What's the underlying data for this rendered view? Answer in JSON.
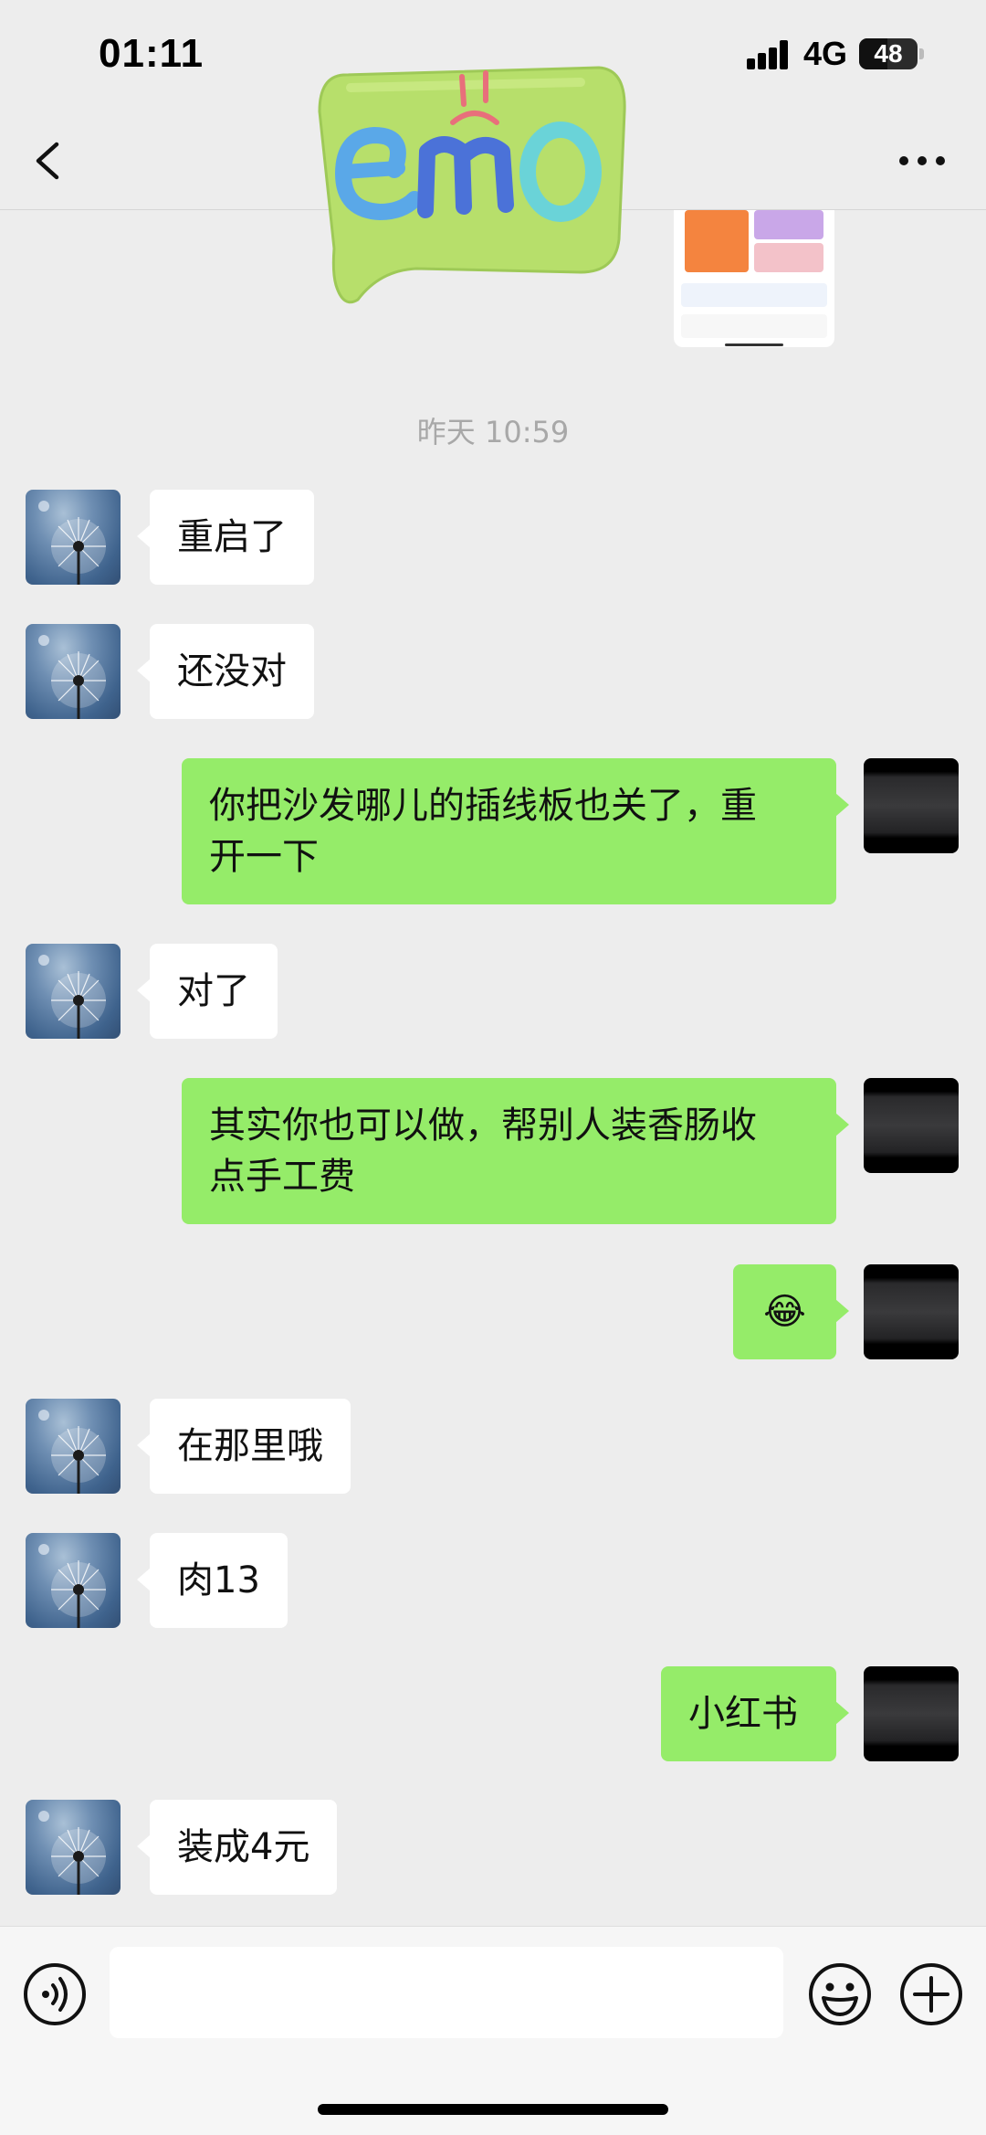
{
  "status_bar": {
    "time": "01:11",
    "network": "4G",
    "battery": "48",
    "battery_level": 0.48
  },
  "nav": {
    "back_icon": "chevron-left-icon",
    "more_icon": "more-dots-icon"
  },
  "sticker": {
    "text": "emo"
  },
  "timestamp": "昨天 10:59",
  "messages": [
    {
      "side": "in",
      "text": "重启了"
    },
    {
      "side": "in",
      "text": "还没对"
    },
    {
      "side": "out",
      "text": "你把沙发哪儿的插线板也关了，重\n开一下"
    },
    {
      "side": "in",
      "text": "对了"
    },
    {
      "side": "out",
      "text": "其实你也可以做，帮别人装香肠收\n点手工费"
    },
    {
      "side": "out",
      "text": "😂"
    },
    {
      "side": "in",
      "text": "在那里哦"
    },
    {
      "side": "in",
      "text": "肉13"
    },
    {
      "side": "out",
      "text": "小红书"
    },
    {
      "side": "in",
      "text": "装成4元"
    }
  ],
  "input_bar": {
    "placeholder": "",
    "voice_icon": "voice-icon",
    "emoji_icon": "emoji-icon",
    "plus_icon": "plus-icon"
  },
  "colors": {
    "background": "#ededed",
    "outgoing_bubble": "#95ec69",
    "incoming_bubble": "#ffffff",
    "timestamp": "#a8a8a8"
  }
}
